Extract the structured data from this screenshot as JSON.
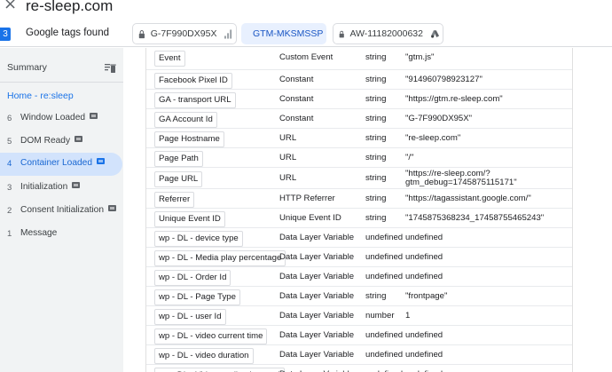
{
  "header": {
    "close_glyph": "×",
    "site_title": "re-sleep.com"
  },
  "tags": {
    "count": "3",
    "found_label": "Google tags found",
    "chips": [
      {
        "label": "G-7F990DX95X",
        "suffix_icon": "bar-chart-icon",
        "active": false
      },
      {
        "label": "GTM-MKSMSSP",
        "suffix_icon": "",
        "active": true
      },
      {
        "label": "AW-11182000632",
        "suffix_icon": "google-ads-icon",
        "active": false
      }
    ]
  },
  "sidebar": {
    "summary_label": "Summary",
    "home_label": "Home - re:sleep",
    "items": [
      {
        "num": "6",
        "label": "Window Loaded",
        "badge": true,
        "active": false
      },
      {
        "num": "5",
        "label": "DOM Ready",
        "badge": true,
        "active": false
      },
      {
        "num": "4",
        "label": "Container Loaded",
        "badge": true,
        "active": true
      },
      {
        "num": "3",
        "label": "Initialization",
        "badge": true,
        "active": false
      },
      {
        "num": "2",
        "label": "Consent Initialization",
        "badge": true,
        "active": false
      },
      {
        "num": "1",
        "label": "Message",
        "badge": false,
        "active": false
      }
    ]
  },
  "variables": {
    "rows": [
      {
        "name": "Event",
        "type": "Custom Event",
        "dtype": "string",
        "value": "\"gtm.js\""
      },
      {
        "name": "Facebook Pixel ID",
        "type": "Constant",
        "dtype": "string",
        "value": "\"914960798923127\""
      },
      {
        "name": "GA - transport URL",
        "type": "Constant",
        "dtype": "string",
        "value": "\"https://gtm.re-sleep.com\""
      },
      {
        "name": "GA Account Id",
        "type": "Constant",
        "dtype": "string",
        "value": "\"G-7F990DX95X\""
      },
      {
        "name": "Page Hostname",
        "type": "URL",
        "dtype": "string",
        "value": "\"re-sleep.com\""
      },
      {
        "name": "Page Path",
        "type": "URL",
        "dtype": "string",
        "value": "\"/\""
      },
      {
        "name": "Page URL",
        "type": "URL",
        "dtype": "string",
        "value": "\"https://re-sleep.com/?",
        "value2": "gtm_debug=1745875115171\"",
        "tall": true
      },
      {
        "name": "Referrer",
        "type": "HTTP Referrer",
        "dtype": "string",
        "value": "\"https://tagassistant.google.com/\""
      },
      {
        "name": "Unique Event ID",
        "type": "Unique Event ID",
        "dtype": "string",
        "value": "\"17458753682​34_17458755465243\""
      },
      {
        "name": "wp - DL - device type",
        "type": "Data Layer Variable",
        "dtype": "undefined",
        "value": "undefined"
      },
      {
        "name": "wp - DL - Media play percentage",
        "type": "Data Layer Variable",
        "dtype": "undefined",
        "value": "undefined"
      },
      {
        "name": "wp - DL - Order Id",
        "type": "Data Layer Variable",
        "dtype": "undefined",
        "value": "undefined"
      },
      {
        "name": "wp - DL - Page Type",
        "type": "Data Layer Variable",
        "dtype": "string",
        "value": "\"frontpage\""
      },
      {
        "name": "wp - DL - user Id",
        "type": "Data Layer Variable",
        "dtype": "number",
        "value": "1"
      },
      {
        "name": "wp - DL - video current time",
        "type": "Data Layer Variable",
        "dtype": "undefined",
        "value": "undefined"
      },
      {
        "name": "wp - DL - video duration",
        "type": "Data Layer Variable",
        "dtype": "undefined",
        "value": "undefined"
      },
      {
        "name": "wp - DL - Video media player url",
        "type": "Data Layer Variable",
        "dtype": "undefined",
        "value": "undefined"
      }
    ]
  },
  "colors": {
    "accent": "#1a73e8",
    "active_nav_bg": "#d2e3fc",
    "sidebar_bg": "#f1f3f4"
  }
}
